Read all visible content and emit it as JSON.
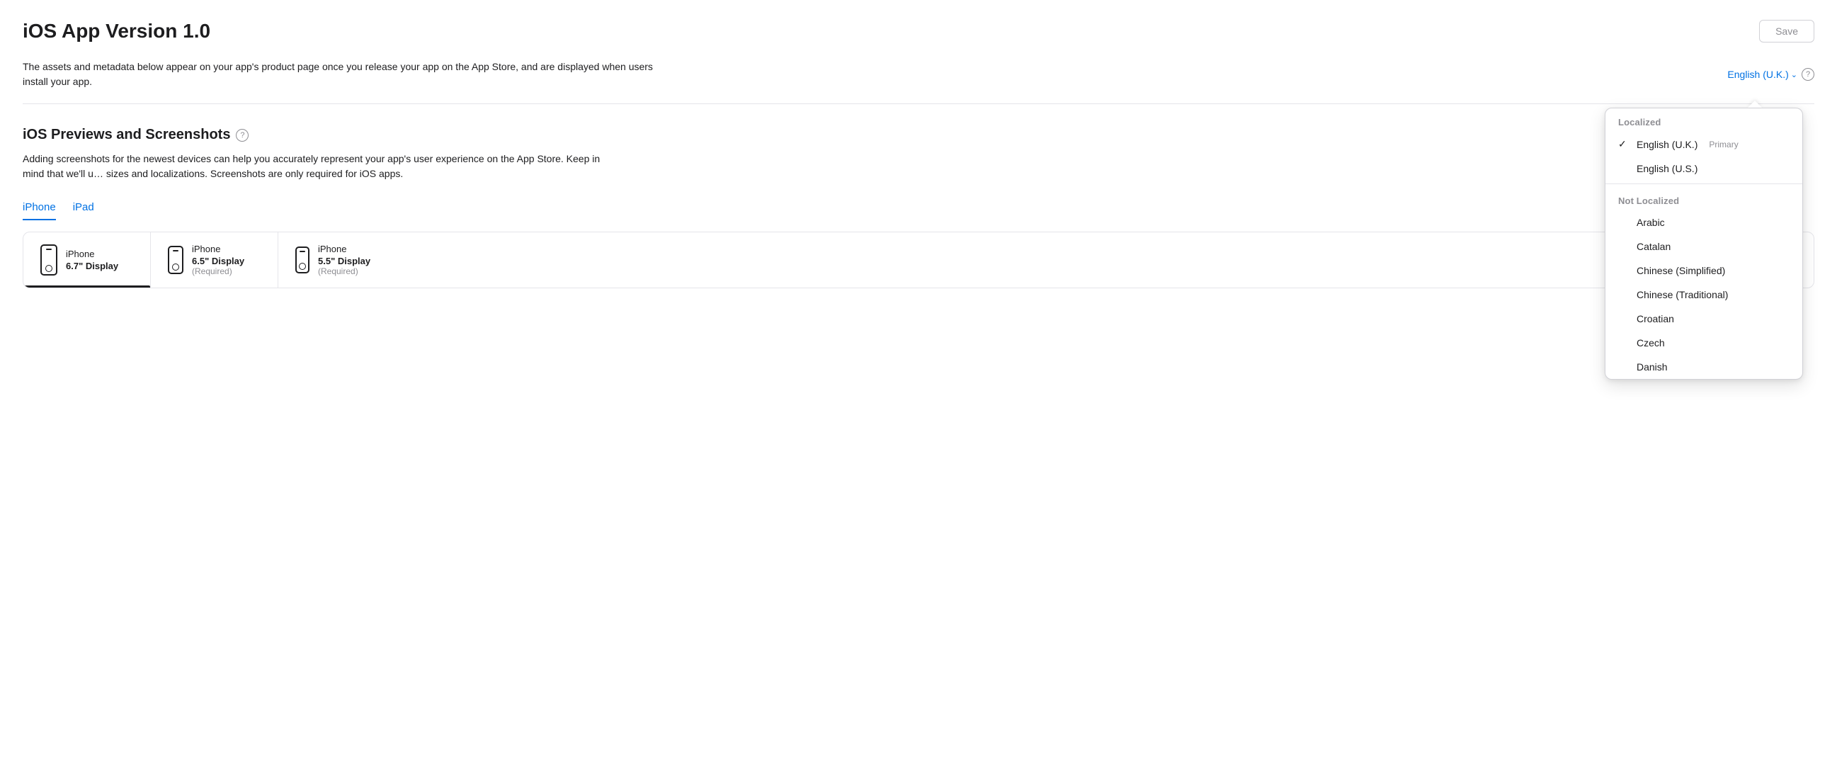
{
  "header": {
    "title": "iOS App Version 1.0",
    "save_button": "Save"
  },
  "description": {
    "text": "The assets and metadata below appear on your app's product page once you release your app on the App Store, and are displayed when users install your app.",
    "language_label": "English (U.K.)",
    "help_label": "?"
  },
  "section": {
    "title": "iOS Previews and Screenshots",
    "help_label": "?",
    "description": "Adding screenshots for the newest devices can help you accurately represent your app's user experience on the App Store. Keep in mind that we'll u... vice sizes and localizations. Screenshots are only required for iOS apps."
  },
  "tabs": [
    {
      "label": "iPhone",
      "active": true
    },
    {
      "label": "iPad",
      "active": false
    }
  ],
  "device_cards": [
    {
      "name": "iPhone",
      "size": "6.7\" Display",
      "required": "",
      "selected": true,
      "size_class": "large"
    },
    {
      "name": "iPhone",
      "size": "6.5\" Display",
      "required": "(Required)",
      "selected": false,
      "size_class": "medium"
    },
    {
      "name": "iPhone",
      "size": "5.5\" Display",
      "required": "(Required)",
      "selected": false,
      "size_class": "small"
    }
  ],
  "dropdown": {
    "localized_section_label": "Localized",
    "not_localized_section_label": "Not Localized",
    "items_localized": [
      {
        "label": "English (U.K.)",
        "selected": true,
        "primary": "Primary"
      },
      {
        "label": "English (U.S.)",
        "selected": false,
        "primary": ""
      }
    ],
    "items_not_localized": [
      {
        "label": "Arabic"
      },
      {
        "label": "Catalan"
      },
      {
        "label": "Chinese (Simplified)"
      },
      {
        "label": "Chinese (Traditional)"
      },
      {
        "label": "Croatian"
      },
      {
        "label": "Czech"
      },
      {
        "label": "Danish"
      }
    ]
  }
}
